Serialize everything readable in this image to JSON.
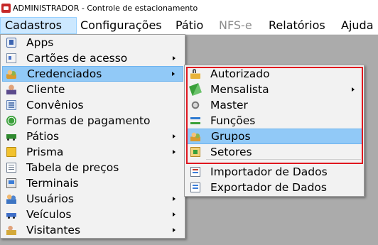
{
  "window": {
    "title": "ADMINISTRADOR - Controle de estacionamento"
  },
  "menubar": {
    "items": [
      {
        "label": "Cadastros",
        "state": "active"
      },
      {
        "label": "Configurações",
        "state": "normal"
      },
      {
        "label": "Pátio",
        "state": "normal"
      },
      {
        "label": "NFS-e",
        "state": "disabled"
      },
      {
        "label": "Relatórios",
        "state": "normal"
      },
      {
        "label": "Ajuda",
        "state": "normal"
      }
    ]
  },
  "cadastros_menu": {
    "items": [
      {
        "label": "Apps",
        "icon": "apps-icon",
        "has_submenu": false
      },
      {
        "label": "Cartões de acesso",
        "icon": "card-icon",
        "has_submenu": true
      },
      {
        "label": "Credenciados",
        "icon": "people-icon",
        "has_submenu": true,
        "highlighted": true
      },
      {
        "label": "Cliente",
        "icon": "person-icon",
        "has_submenu": false
      },
      {
        "label": "Convênios",
        "icon": "document-icon",
        "has_submenu": false
      },
      {
        "label": "Formas de pagamento",
        "icon": "payment-icon",
        "has_submenu": false
      },
      {
        "label": "Pátios",
        "icon": "truck-icon",
        "has_submenu": true
      },
      {
        "label": "Prisma",
        "icon": "prisma-icon",
        "has_submenu": true
      },
      {
        "label": "Tabela de preços",
        "icon": "table-icon",
        "has_submenu": false
      },
      {
        "label": "Terminais",
        "icon": "terminal-icon",
        "has_submenu": false
      },
      {
        "label": "Usuários",
        "icon": "users-icon",
        "has_submenu": true
      },
      {
        "label": "Veículos",
        "icon": "car-icon",
        "has_submenu": true
      },
      {
        "label": "Visitantes",
        "icon": "visitor-icon",
        "has_submenu": true
      }
    ]
  },
  "credenciados_submenu": {
    "items": [
      {
        "label": "Autorizado",
        "icon": "lock-icon",
        "has_submenu": false
      },
      {
        "label": "Mensalista",
        "icon": "money-icon",
        "has_submenu": true
      },
      {
        "label": "Master",
        "icon": "gear-icon",
        "has_submenu": false
      },
      {
        "label": "Funções",
        "icon": "hierarchy-icon",
        "has_submenu": false
      },
      {
        "label": "Grupos",
        "icon": "group-icon",
        "has_submenu": false,
        "highlighted": true
      },
      {
        "label": "Setores",
        "icon": "sector-icon",
        "has_submenu": false
      },
      {
        "label": "Importador de Dados",
        "icon": "import-icon",
        "has_submenu": false
      },
      {
        "label": "Exportador de Dados",
        "icon": "export-icon",
        "has_submenu": false
      }
    ]
  },
  "annotation": {
    "highlight_color": "#e0161f"
  }
}
